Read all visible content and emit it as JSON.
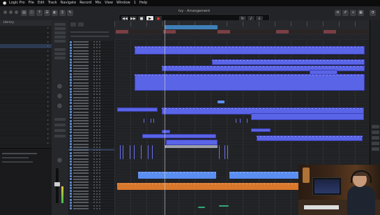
{
  "system_menu": {
    "apple": "",
    "items": [
      "Logic Pro",
      "File",
      "Edit",
      "Track",
      "Navigate",
      "Record",
      "Mix",
      "View",
      "Window",
      "1",
      "Help"
    ],
    "clock": ""
  },
  "window": {
    "title": "Ivy - Arrangement"
  },
  "transport": {
    "position": "",
    "tempo": "",
    "signature": ""
  },
  "library": {
    "header": [
      "Library",
      "",
      ""
    ]
  },
  "colors": {
    "accent_blue": "#5a64e6",
    "light_blue": "#5a8ef0",
    "orange": "#d9772a",
    "playhead": "#d8d8d8",
    "cycle": "#3f7fb8"
  }
}
